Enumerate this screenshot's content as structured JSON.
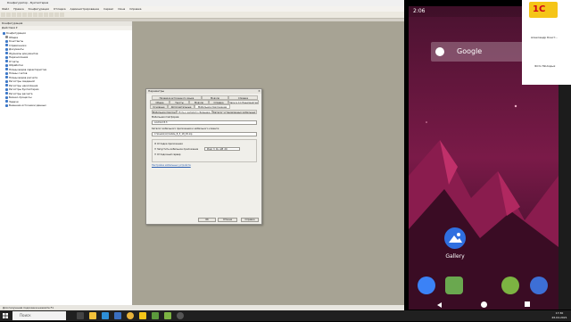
{
  "configurator": {
    "title": "Конфигуратор - Бухгалтерия",
    "menu": [
      "Файл",
      "Правка",
      "Конфигурация",
      "Отладка",
      "Администрирование",
      "Сервис",
      "Окна",
      "Справка"
    ],
    "tree": {
      "title": "Конфигурация",
      "toolbar_label": "Действия ▾",
      "items": [
        {
          "label": "Конфигурация",
          "color": "#3c78c8"
        },
        {
          "label": "Общие",
          "color": "#8a8a8a"
        },
        {
          "label": "Константы",
          "color": "#3c78c8"
        },
        {
          "label": "Справочники",
          "color": "#3c78c8"
        },
        {
          "label": "Документы",
          "color": "#3c78c8"
        },
        {
          "label": "Журналы документов",
          "color": "#3c78c8"
        },
        {
          "label": "Перечисления",
          "color": "#3c78c8"
        },
        {
          "label": "Отчеты",
          "color": "#3c78c8"
        },
        {
          "label": "Обработки",
          "color": "#3c78c8"
        },
        {
          "label": "Планы видов характеристик",
          "color": "#3c78c8"
        },
        {
          "label": "Планы счетов",
          "color": "#3c78c8"
        },
        {
          "label": "Планы видов расчета",
          "color": "#3c78c8"
        },
        {
          "label": "Регистры сведений",
          "color": "#3c78c8"
        },
        {
          "label": "Регистры накопления",
          "color": "#3c78c8"
        },
        {
          "label": "Регистры бухгалтерии",
          "color": "#3c78c8"
        },
        {
          "label": "Регистры расчета",
          "color": "#3c78c8"
        },
        {
          "label": "Бизнес-процессы",
          "color": "#3c78c8"
        },
        {
          "label": "Задачи",
          "color": "#3c78c8"
        },
        {
          "label": "Внешние источники данных",
          "color": "#3c78c8"
        }
      ]
    },
    "status": "Для получения подсказки нажмите F1"
  },
  "dialog": {
    "title": "Параметры",
    "tabs_row1": [
      "Проверка встроенного языка",
      "Модули",
      "Справка"
    ],
    "tabs_row2": [
      "Общие",
      "Тексты",
      "Модули",
      "Справка",
      "Запуск 1С:Предприятия"
    ],
    "tabs_row3": [
      "Основные",
      "Дополнительные",
      "Мобильное приложение"
    ],
    "sub_tabs": [
      "Мобильное приложение",
      "Путь к каталогу сборщика",
      "Каталог установленных мобильных приложений"
    ],
    "label_version": "Мобильная платформа:",
    "version_value": "Android 8.3",
    "label_path": "Каталог мобильного приложения и мобильного клиента:",
    "path_value": "C:\\Users\\1c\\mobile_8_3_18_45.zip",
    "check1": "Отладка приложения",
    "check2": "Запустить мобильное приложение",
    "device_value": "Pixel_3_XL_API_29",
    "check3": "Отладочный сервер",
    "link": "Настройка мобильных устройств",
    "btn_ok": "OK",
    "btn_cancel": "Отмена",
    "btn_help": "Справка"
  },
  "android": {
    "time": "2:06",
    "search_placeholder": "Google",
    "app_label": "Gallery",
    "accent": "#e8338a"
  },
  "ad": {
    "name1": "Александр Конст...",
    "name2": "Фото Молодых"
  },
  "taskbar": {
    "search_placeholder": "Поиск",
    "time": "17:30",
    "date": "26.04.2021"
  }
}
